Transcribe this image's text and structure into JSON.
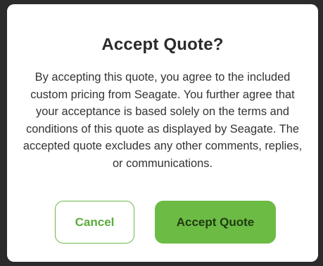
{
  "dialog": {
    "title": "Accept Quote?",
    "message": "By accepting this quote, you agree to the included custom pricing from Seagate. You further agree that your acceptance is based solely on the terms and conditions of this quote as displayed by Seagate. The accepted quote excludes any other comments, replies, or communications.",
    "cancel_label": "Cancel",
    "accept_label": "Accept Quote"
  },
  "colors": {
    "accent": "#6cbb45",
    "cancel_border": "#6bb84a",
    "backdrop": "#2b2b2b"
  }
}
